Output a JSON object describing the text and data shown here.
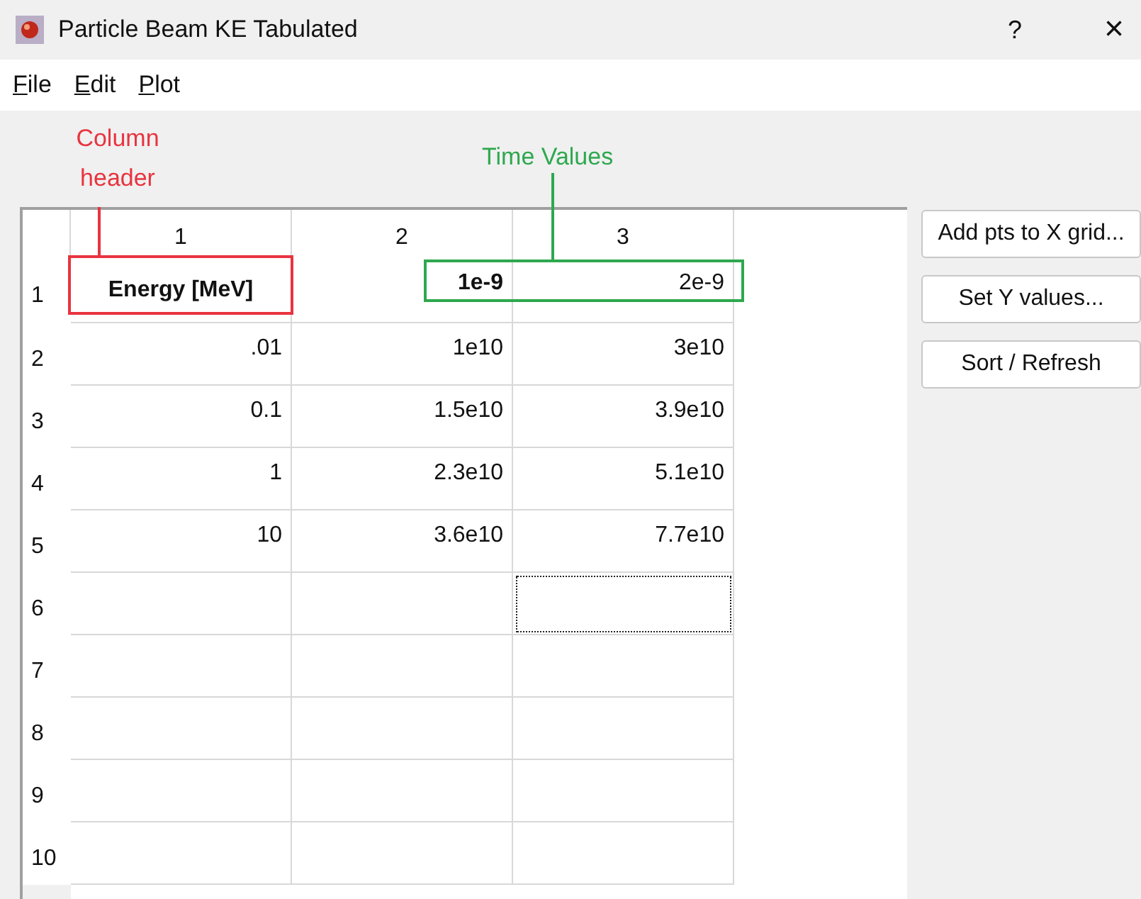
{
  "window": {
    "title": "Particle Beam KE Tabulated",
    "help": "?",
    "close": "×"
  },
  "menu": [
    "File",
    "Edit",
    "Plot"
  ],
  "annotations": [
    {
      "kind": "red",
      "label": "Column header"
    },
    {
      "kind": "green",
      "label": "Time Values"
    }
  ],
  "table": {
    "columns": [
      "1",
      "2",
      "3"
    ],
    "rows": [
      {
        "label": "1",
        "cells": [
          {
            "text": "Energy [MeV]",
            "bold": true,
            "focused": false
          },
          {
            "text": "1e-9",
            "bold": true,
            "focused": false
          },
          {
            "text": "2e-9",
            "bold": false,
            "focused": false
          }
        ]
      },
      {
        "label": "2",
        "cells": [
          {
            "text": ".01",
            "bold": false,
            "focused": false
          },
          {
            "text": "1e10",
            "bold": false,
            "focused": false
          },
          {
            "text": "3e10",
            "bold": false,
            "focused": false
          }
        ]
      },
      {
        "label": "3",
        "cells": [
          {
            "text": "0.1",
            "bold": false,
            "focused": false
          },
          {
            "text": "1.5e10",
            "bold": false,
            "focused": false
          },
          {
            "text": "3.9e10",
            "bold": false,
            "focused": false
          }
        ]
      },
      {
        "label": "4",
        "cells": [
          {
            "text": "1",
            "bold": false,
            "focused": false
          },
          {
            "text": "2.3e10",
            "bold": false,
            "focused": false
          },
          {
            "text": "5.1e10",
            "bold": false,
            "focused": false
          }
        ]
      },
      {
        "label": "5",
        "cells": [
          {
            "text": "10",
            "bold": false,
            "focused": false
          },
          {
            "text": "3.6e10",
            "bold": false,
            "focused": false
          },
          {
            "text": "7.7e10",
            "bold": false,
            "focused": false
          }
        ]
      },
      {
        "label": "6",
        "cells": [
          {
            "focused": false
          },
          {
            "focused": false
          },
          {
            "focused": true
          }
        ]
      },
      {
        "label": "7",
        "cells": [
          {
            "focused": false
          },
          {
            "focused": false
          },
          {
            "focused": false
          }
        ]
      },
      {
        "label": "8",
        "cells": [
          {
            "focused": false
          },
          {
            "focused": false
          },
          {
            "focused": false
          }
        ]
      },
      {
        "label": "9",
        "cells": [
          {
            "focused": false
          },
          {
            "focused": false
          },
          {
            "focused": false
          }
        ]
      },
      {
        "label": "10",
        "cells": [
          {
            "focused": false
          },
          {
            "focused": false
          },
          {
            "focused": false
          }
        ]
      }
    ]
  },
  "buttons": [
    "Add pts to X grid...",
    "Set Y values...",
    "Sort / Refresh"
  ]
}
